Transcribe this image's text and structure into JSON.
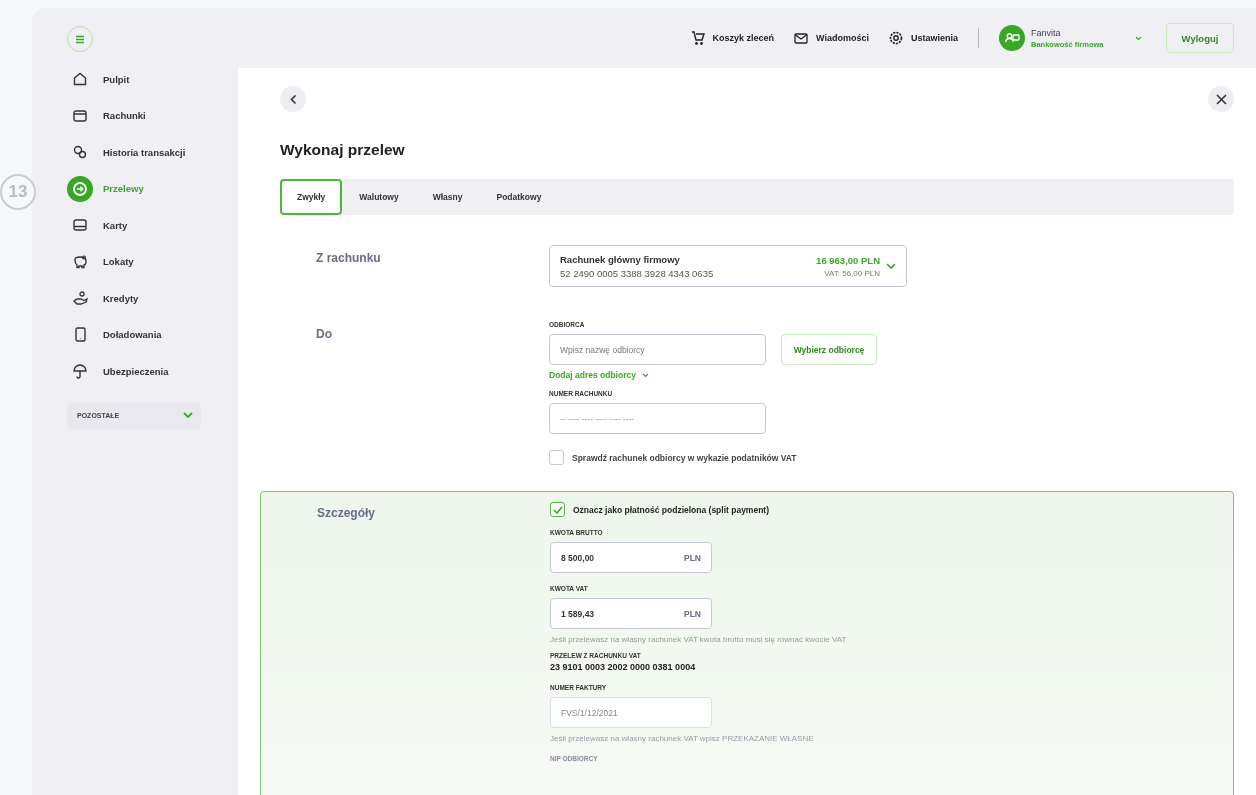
{
  "step_marker": "13",
  "sidebar": {
    "items": [
      {
        "label": "Pulpit",
        "selected": false
      },
      {
        "label": "Rachunki",
        "selected": false
      },
      {
        "label": "Historia transakcji",
        "selected": false
      },
      {
        "label": "Przelewy",
        "selected": true
      },
      {
        "label": "Karty",
        "selected": false
      },
      {
        "label": "Lokaty",
        "selected": false
      },
      {
        "label": "Kredyty",
        "selected": false
      },
      {
        "label": "Doładowania",
        "selected": false
      },
      {
        "label": "Ubezpieczenia",
        "selected": false
      }
    ],
    "more": {
      "label": "POZOSTAŁE",
      "expanded": false
    }
  },
  "topbar": {
    "links": [
      "Koszyk zleceń",
      "Wiadomości",
      "Ustawienia"
    ],
    "user": {
      "name": "Fanvita",
      "subtitle": "Bankowość firmowa"
    },
    "logout": "Wyloguj"
  },
  "page": {
    "title": "Wykonaj przelew",
    "tabs": [
      {
        "label": "Zwykły",
        "selected": true
      },
      {
        "label": "Walutowy",
        "selected": false
      },
      {
        "label": "Własny",
        "selected": false
      },
      {
        "label": "Podatkowy",
        "selected": false
      }
    ],
    "from": {
      "label": "Z rachunku",
      "account_name": "Rachunek główny firmowy",
      "account_number": "52 2490 0005 3388 3928 4343 0635",
      "balance": "16 963,00 PLN",
      "vat": "VAT: 56,00 PLN"
    },
    "to": {
      "label": "Do",
      "recipient_label": "ODBIORCA",
      "recipient_placeholder": "Wpisz nazwę odbiorcy",
      "choose_button": "Wybierz odbiorcę",
      "add_address": "Dodaj adres odbiorcy",
      "account_label": "NUMER RACHUNKU",
      "account_placeholder": "-- ---- ---- ---- ---- ----",
      "vat_check": {
        "label": "Sprawdź rachunek odbiorcy w wykazie podatników VAT",
        "checked": false
      }
    },
    "details": {
      "label": "Szczegóły",
      "split_payment": {
        "label": "Oznacz jako płatność podzielona (split payment)",
        "checked": true
      },
      "gross_label": "KWOTA BRUTTO",
      "gross_value": "8 500,00",
      "gross_currency": "PLN",
      "vat_label": "KWOTA VAT",
      "vat_value": "1 589,43",
      "vat_currency": "PLN",
      "vat_hint": "Jeśli przelewasz na własny rachunek VAT kwota brutto musi się równać kwocie VAT",
      "vat_account_label": "PRZELEW Z RACHUNKU VAT",
      "vat_account": "23 9101 0003 2002 0000 0381 0004",
      "invoice_label": "NUMER FAKTURY",
      "invoice_placeholder": "FVS/1/12/2021",
      "invoice_hint": "Jeśli przelewasz na własny rachunek VAT wpisz PRZEKAZANIE WŁASNE",
      "nip_label": "NIP ODBIORCY"
    }
  }
}
